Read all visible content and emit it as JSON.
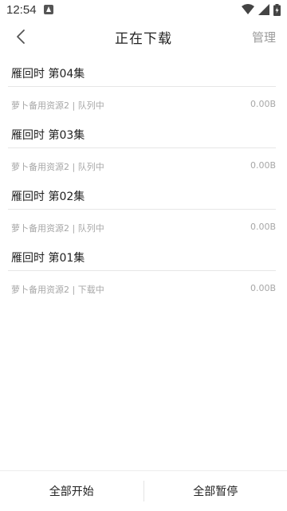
{
  "status_bar": {
    "time": "12:54",
    "icons": [
      "notification-icon",
      "wifi-icon",
      "signal-icon",
      "battery-icon"
    ]
  },
  "header": {
    "title": "正在下载",
    "manage_label": "管理",
    "back_icon": "chevron-left-icon"
  },
  "downloads": [
    {
      "title": "雁回时 第04集",
      "status": "萝卜备用资源2 | 队列中",
      "size": "0.00B"
    },
    {
      "title": "雁回时 第03集",
      "status": "萝卜备用资源2 | 队列中",
      "size": "0.00B"
    },
    {
      "title": "雁回时 第02集",
      "status": "萝卜备用资源2 | 队列中",
      "size": "0.00B"
    },
    {
      "title": "雁回时 第01集",
      "status": "萝卜备用资源2 | 下载中",
      "size": "0.00B"
    }
  ],
  "footer": {
    "start_all_label": "全部开始",
    "pause_all_label": "全部暂停"
  },
  "colors": {
    "primary_text": "#222222",
    "secondary_text": "#a7a7a7",
    "manage_text": "#9a9a9a",
    "divider": "#e6e6e6"
  }
}
